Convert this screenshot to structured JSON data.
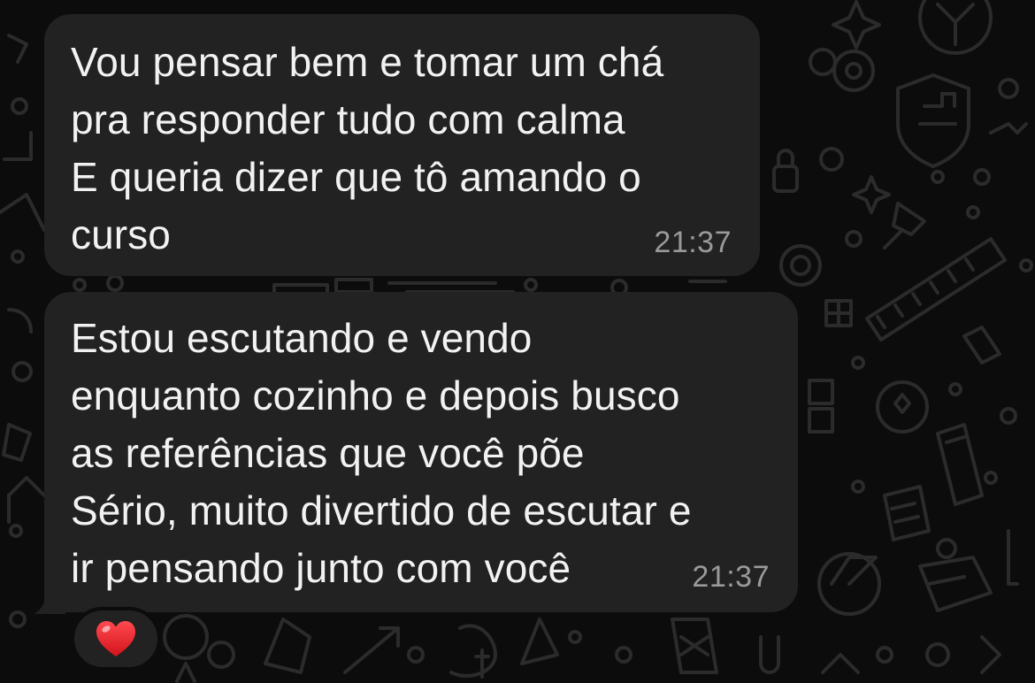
{
  "chat": {
    "background_color": "#0c0c0c",
    "bubble_color": "#222222",
    "messages": [
      {
        "lines": [
          "Vou pensar bem e tomar um chá",
          "pra responder tudo com calma",
          "E queria dizer que tô amando o",
          "curso"
        ],
        "time": "21:37"
      },
      {
        "lines": [
          "Estou escutando e vendo",
          "enquanto cozinho e depois busco",
          "as referências que você põe",
          "Sério, muito divertido de escutar e",
          "ir pensando junto com você"
        ],
        "time": "21:37",
        "reaction": {
          "icon": "red-heart-icon",
          "color": "#e8212c"
        }
      }
    ]
  }
}
